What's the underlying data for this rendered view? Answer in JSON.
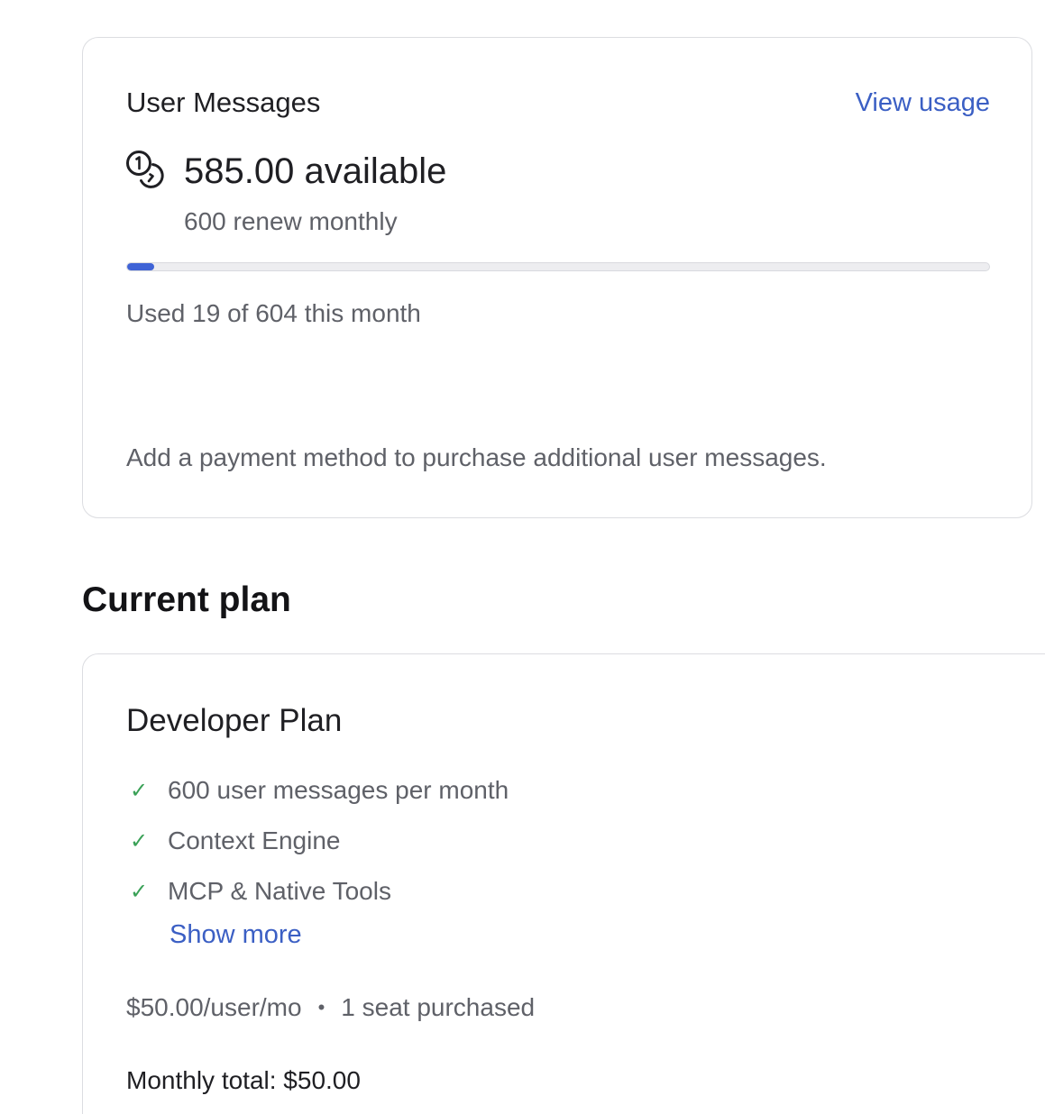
{
  "usage": {
    "title": "User Messages",
    "view_usage_label": "View usage",
    "available_text": "585.00 available",
    "renew_text": "600 renew monthly",
    "progress_fraction": 0.031,
    "used_text": "Used 19 of 604 this month",
    "payment_note": "Add a payment method to purchase additional user messages.",
    "icon": "coins-icon",
    "accent_color": "#3f63d6"
  },
  "plan": {
    "section_title": "Current plan",
    "name": "Developer Plan",
    "features": [
      "600 user messages per month",
      "Context Engine",
      "MCP & Native Tools"
    ],
    "check_icon": "✓",
    "show_more_label": "Show more",
    "price": "$50.00/user/mo",
    "separator": "•",
    "seats": "1 seat purchased",
    "total": "Monthly total: $50.00",
    "check_color": "#3aa157",
    "link_color": "#3b5fc4"
  }
}
